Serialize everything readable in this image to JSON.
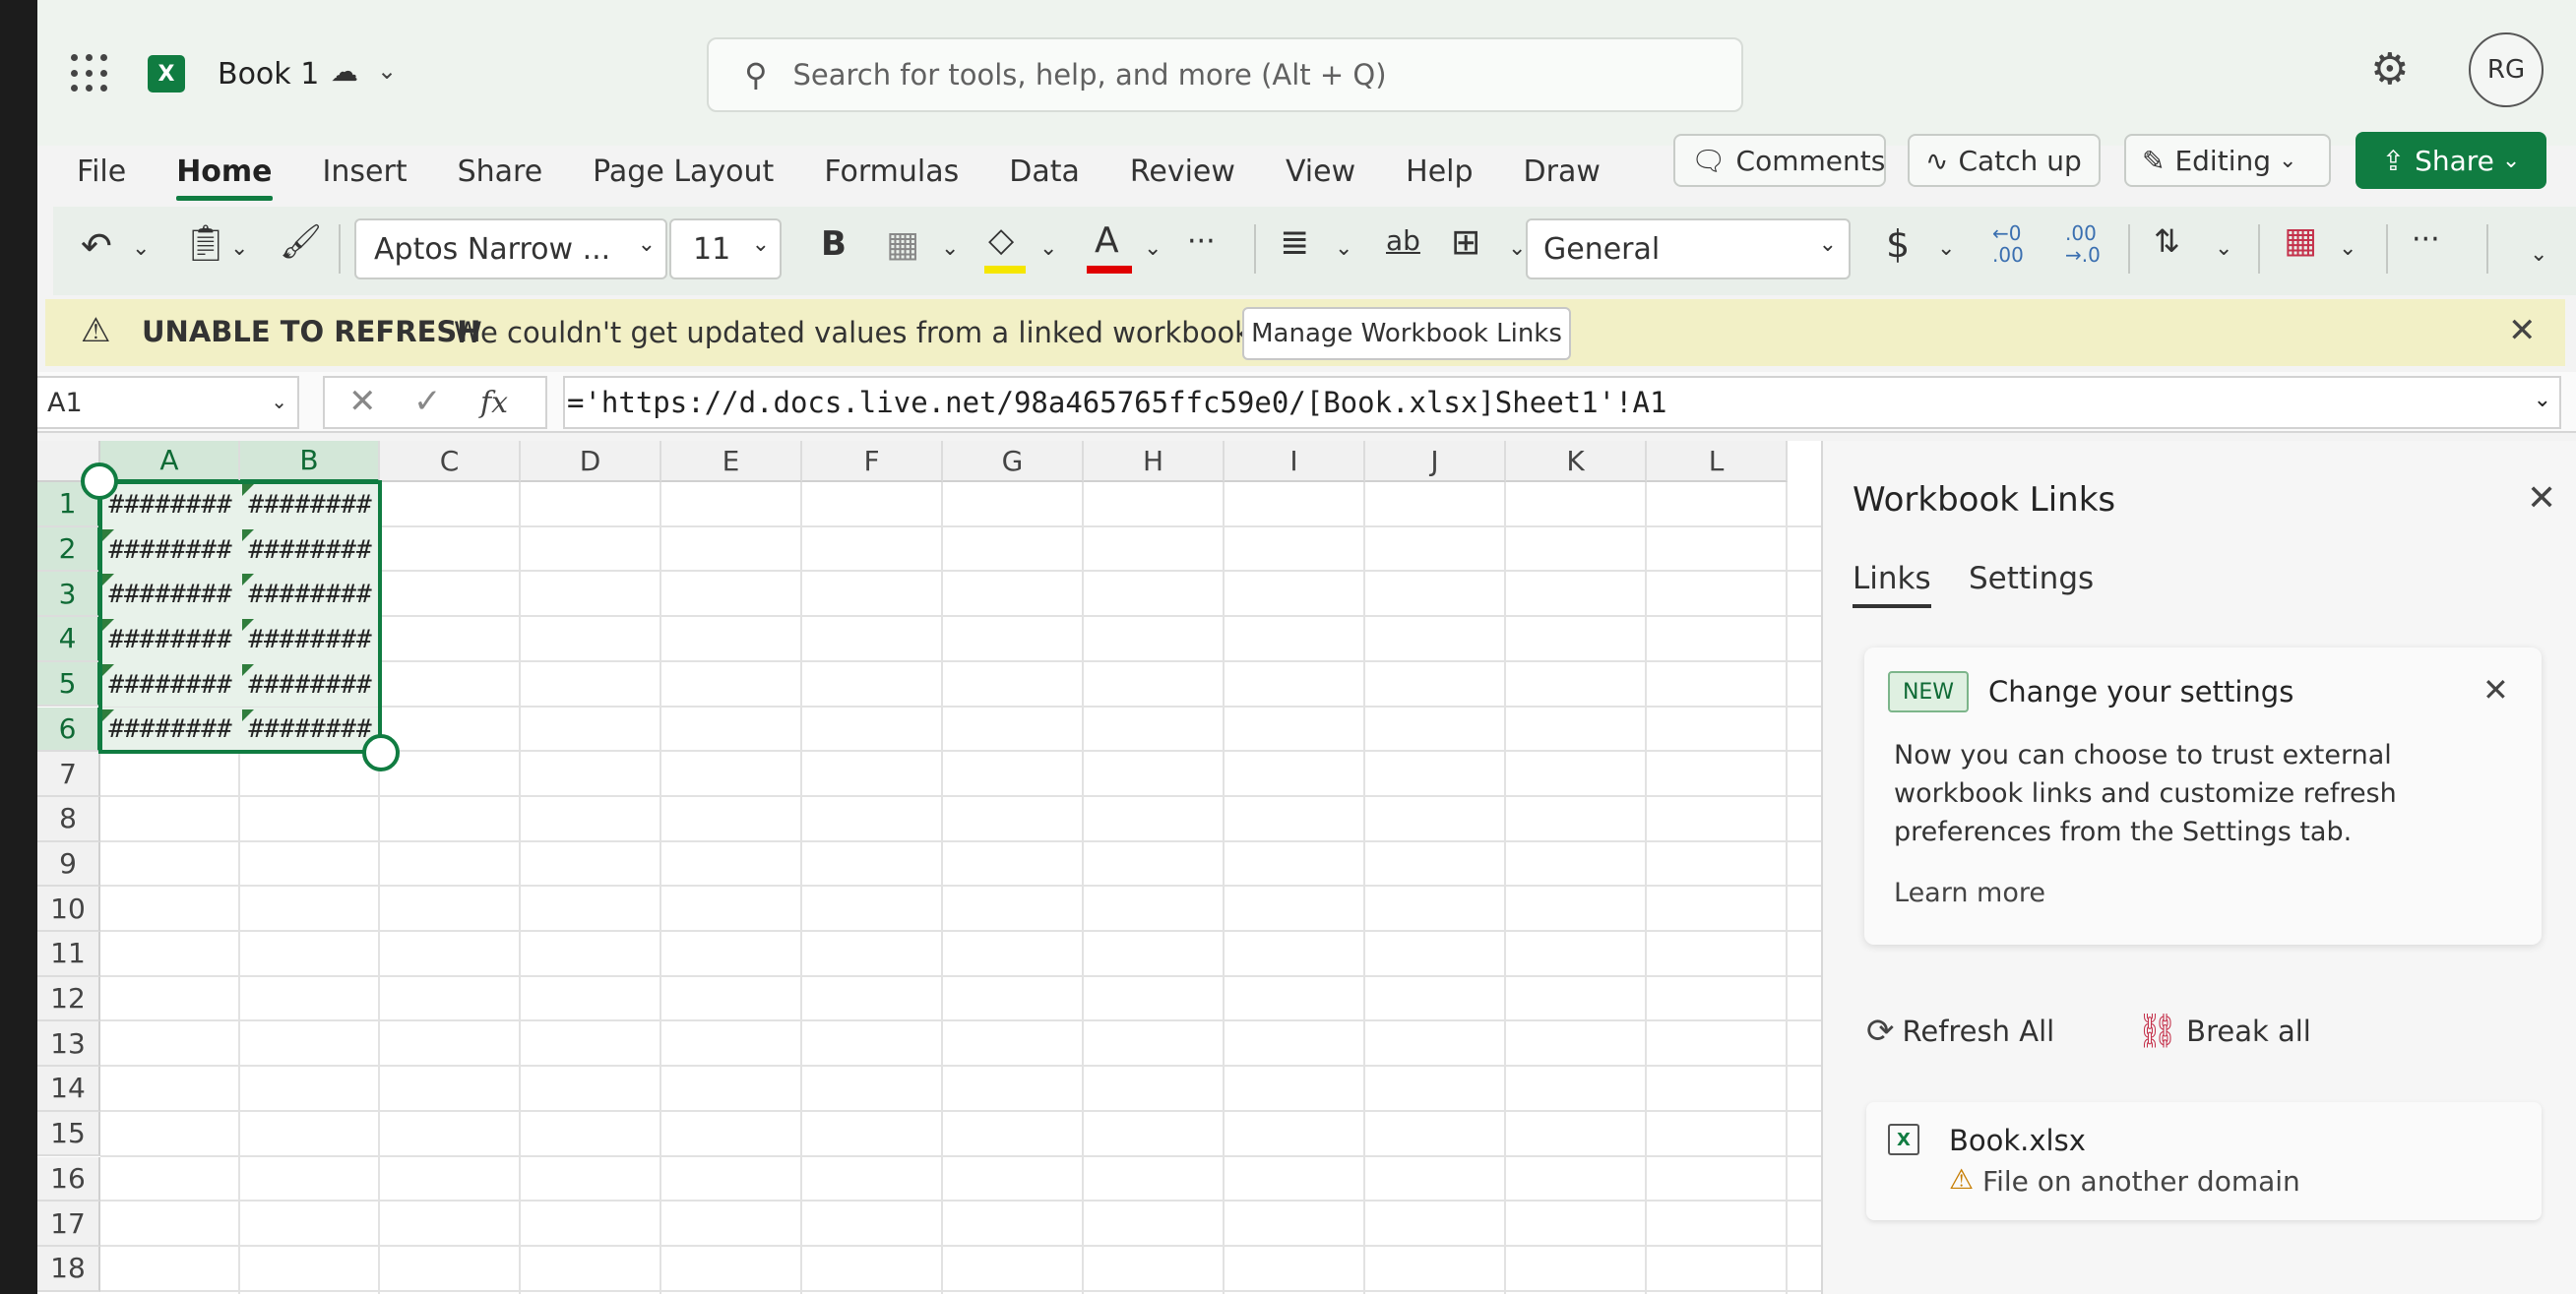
{
  "titlebar": {
    "app_icon": "excel-icon",
    "app_letter": "X",
    "doc_name": "Book 1",
    "save_status_icon": "saved-cloud-icon",
    "search_placeholder": "Search for tools, help, and more (Alt + Q)",
    "avatar_initials": "RG"
  },
  "menu": {
    "items": [
      "File",
      "Home",
      "Insert",
      "Share",
      "Page Layout",
      "Formulas",
      "Data",
      "Review",
      "View",
      "Help",
      "Draw"
    ],
    "active": "Home",
    "comments": "Comments",
    "catch_up": "Catch up",
    "editing": "Editing",
    "share": "Share"
  },
  "ribbon": {
    "font_name": "Aptos Narrow ...",
    "font_size": "11",
    "bold": "B",
    "font_color_letter": "A",
    "more": "···",
    "wrap": "ab",
    "number_format": "General",
    "currency": "$",
    "dec_decrease_top": "←0",
    "dec_decrease_bottom": ".00",
    "dec_increase_top": ".00",
    "dec_increase_bottom": "→.0",
    "highlight_color": "#f5e600",
    "font_color": "#e00000"
  },
  "banner": {
    "title": "UNABLE TO REFRESH",
    "message": "We couldn't get updated values from a linked workbook.",
    "button": "Manage Workbook Links"
  },
  "formula_bar": {
    "name_box": "A1",
    "fx": "fx",
    "formula": "='https://d.docs.live.net/98a465765ffc59e0/[Book.xlsx]Sheet1'!A1"
  },
  "sheet": {
    "columns": [
      "A",
      "B",
      "C",
      "D",
      "E",
      "F",
      "G",
      "H",
      "I",
      "J",
      "K",
      "L"
    ],
    "rows": [
      "1",
      "2",
      "3",
      "4",
      "5",
      "6",
      "7",
      "8",
      "9",
      "10",
      "11",
      "12",
      "13",
      "14",
      "15",
      "16",
      "17",
      "18"
    ],
    "cell_value": "########",
    "filled_rows": 6,
    "filled_cols": 2,
    "accent": "#107c41"
  },
  "pane": {
    "title": "Workbook Links",
    "tabs": [
      "Links",
      "Settings"
    ],
    "active_tab": "Links",
    "card": {
      "badge": "NEW",
      "title": "Change your settings",
      "body": "Now you can choose to trust external workbook links and customize refresh preferences from the Settings tab.",
      "learn_more": "Learn more"
    },
    "refresh_all": "Refresh All",
    "break_all": "Break all",
    "link": {
      "file_name": "Book.xlsx",
      "warning": "File on another domain"
    }
  }
}
